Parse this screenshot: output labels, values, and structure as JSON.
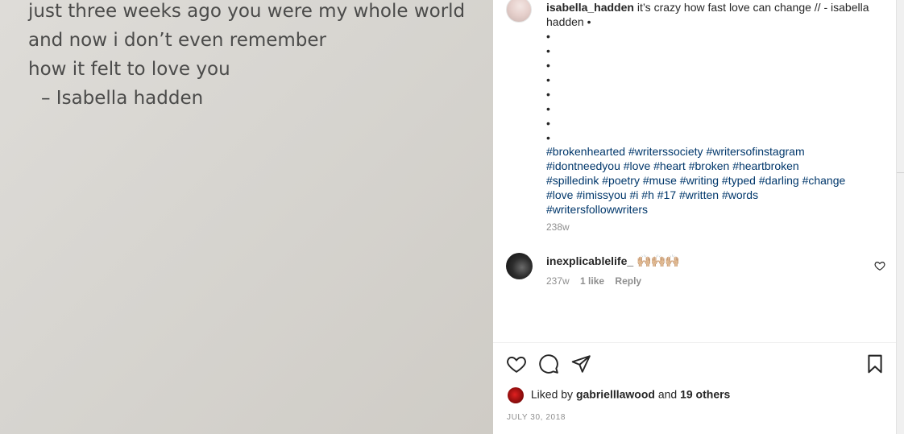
{
  "poem": {
    "lines": [
      "just three weeks ago you were my whole world",
      "and now i don’t even remember",
      "how it felt to love you"
    ],
    "signature": "–   Isabella hadden"
  },
  "post": {
    "author": "isabella_hadden",
    "caption_text": "it’s crazy how fast love can change // - isabella hadden •",
    "bullets": [
      "•",
      "•",
      "•",
      "•",
      "•",
      "•",
      "•",
      "•"
    ],
    "hashtags": [
      [
        "#brokenhearted",
        "#writerssociety",
        "#writersofinstagram"
      ],
      [
        "#idontneedyou",
        "#love",
        "#heart",
        "#broken",
        "#heartbroken"
      ],
      [
        "#spilledink",
        "#poetry",
        "#muse",
        "#writing",
        "#typed",
        "#darling",
        "#change"
      ],
      [
        "#love",
        "#imissyou",
        "#i",
        "#h",
        "#17",
        "#written",
        "#words"
      ],
      [
        "#writersfollowwriters"
      ]
    ],
    "age": "238w"
  },
  "comment": {
    "user": "inexplicablelife_",
    "text": "🙌🏼🙌🏼🙌🏼",
    "age": "237w",
    "likes": "1 like",
    "reply": "Reply"
  },
  "likes": {
    "prefix": "Liked by",
    "user": "gabrielllawood",
    "and": "and",
    "others": "19 others"
  },
  "date": "JULY 30, 2018",
  "icons": [
    "heart-icon",
    "comment-icon",
    "share-icon",
    "bookmark-icon"
  ]
}
